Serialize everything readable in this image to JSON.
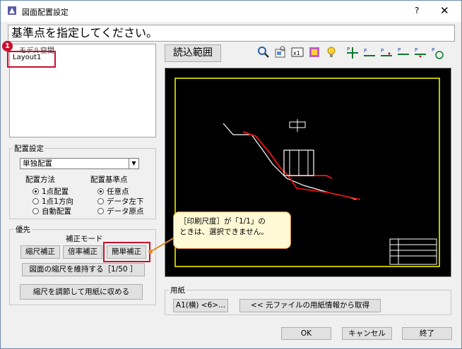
{
  "window": {
    "title": "図面配置設定",
    "help_label": "?",
    "close_label": "✕"
  },
  "prompt": "基準点を指定してください。",
  "layout_list": {
    "header": "モデル空間",
    "items": [
      "Layout1"
    ]
  },
  "badge": "1",
  "placement": {
    "group_title": "配置設定",
    "mode_value": "単独配置",
    "method_title": "配置方法",
    "method_options": [
      "1点配置",
      "1点1方向",
      "自動配置"
    ],
    "method_selected": 0,
    "base_title": "配置基準点",
    "base_options": [
      "任意点",
      "データ左下",
      "データ原点"
    ],
    "base_selected": 0
  },
  "priority": {
    "group_title": "優先",
    "correction_mode_label": "補正モード",
    "buttons": [
      "縮尺補正",
      "倍率補正",
      "簡単補正"
    ],
    "keep_scale_button": "図面の縮尺を維持する［1/50 ］",
    "fit_paper_button": "縮尺を調節して用紙に収める"
  },
  "toolbar": {
    "read_range_button": "読込範囲",
    "icons": [
      "zoom-icon",
      "window-zoom-icon",
      "fit-icon",
      "layer-icon",
      "bulb-icon",
      "point-icon-1",
      "point-icon-2",
      "point-icon-3",
      "point-icon-4",
      "point-icon-5",
      "point-icon-6"
    ]
  },
  "paper": {
    "group_title": "用紙",
    "size_button": "A1(横) <6>...",
    "get_from_source_button": "<<  元ファイルの用紙情報から取得"
  },
  "callout": {
    "line1": "［印刷尺度］が「1/1」の",
    "line2": "ときは、選択できません。"
  },
  "footer": {
    "ok": "OK",
    "cancel": "キャンセル",
    "exit": "終了"
  },
  "colors": {
    "accent_red": "#c8102e",
    "callout_border": "#e08a2e",
    "callout_bg": "#fff9d6",
    "drawing_frame": "#ffff00"
  }
}
